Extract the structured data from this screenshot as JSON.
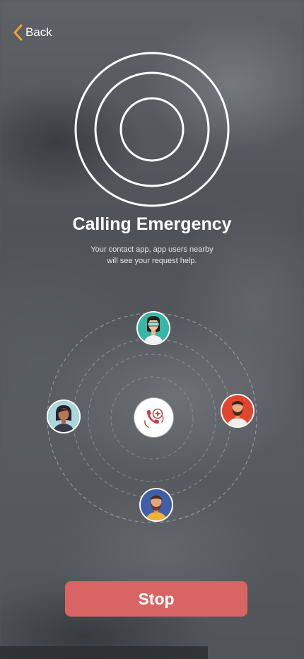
{
  "nav": {
    "back_label": "Back"
  },
  "main": {
    "title": "Calling Emergency",
    "subtitle_line1": "Your contact app, app users nearby",
    "subtitle_line2": "will see your request help."
  },
  "contacts": [
    {
      "icon": "avatar-woman-glasses"
    },
    {
      "icon": "avatar-woman-dark-hair"
    },
    {
      "icon": "avatar-man-beard-red-bg"
    },
    {
      "icon": "avatar-man-beard-blue-bg"
    }
  ],
  "center": {
    "icon": "emergency-call-icon"
  },
  "actions": {
    "stop_label": "Stop"
  },
  "colors": {
    "accent_orange": "#f5a12f",
    "stop_button": "#d86563",
    "text_white": "#ffffff"
  }
}
